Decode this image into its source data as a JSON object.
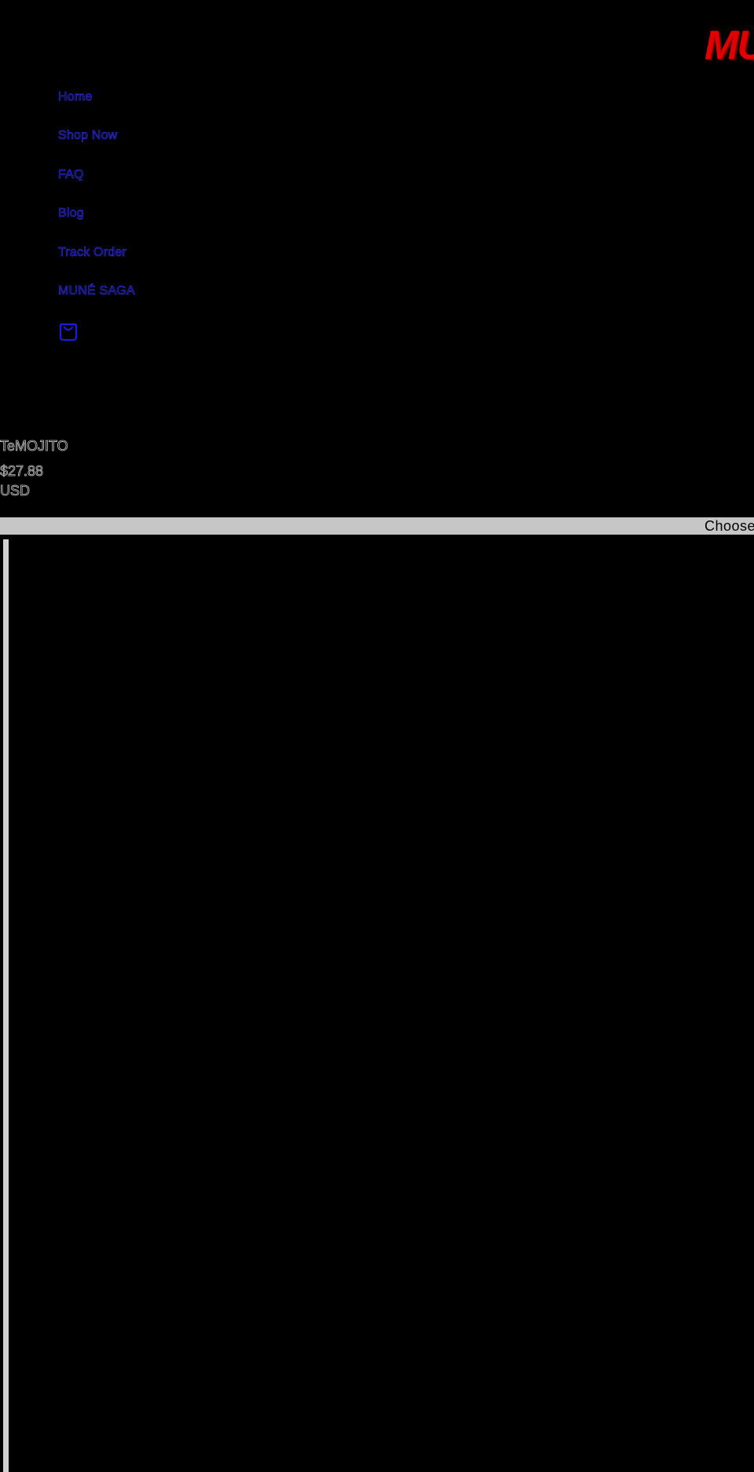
{
  "brand": {
    "logo_text": "MU",
    "logo_color": "#e00000"
  },
  "nav": {
    "link_color": "#2a2ad8",
    "items": [
      {
        "label": "Home"
      },
      {
        "label": "Shop Now"
      },
      {
        "label": "FAQ"
      },
      {
        "label": "Blog"
      },
      {
        "label": "Track Order"
      },
      {
        "label": "MUNÉ SAGA"
      }
    ],
    "cart_icon": "shopping-bag-icon"
  },
  "product": {
    "title": "TeMOJITO",
    "price": "$27.88",
    "currency": "USD"
  },
  "options": {
    "choose_label": "Choose"
  }
}
